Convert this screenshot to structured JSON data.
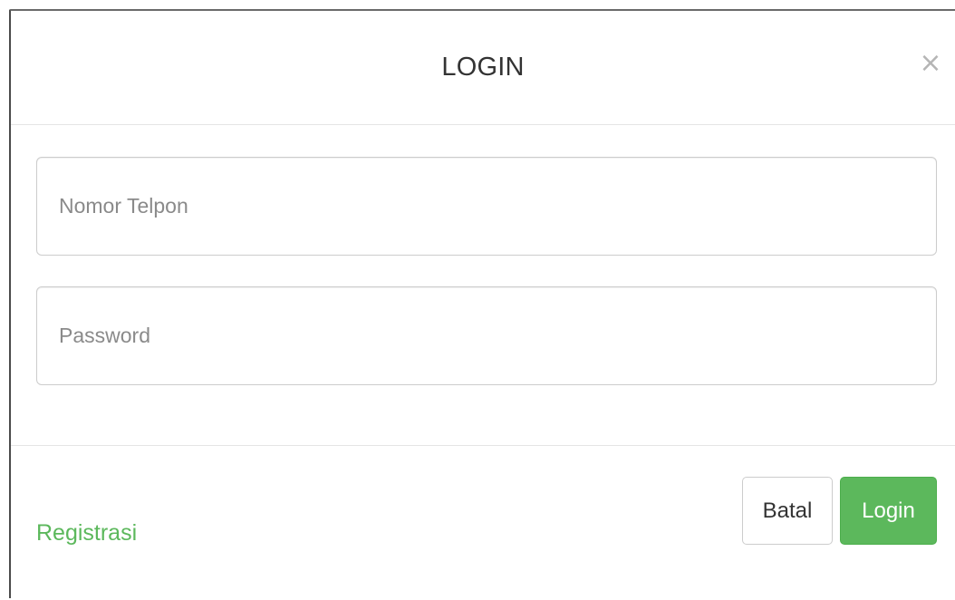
{
  "modal": {
    "title": "LOGIN",
    "close_symbol": "×"
  },
  "form": {
    "phone": {
      "placeholder": "Nomor Telpon",
      "value": ""
    },
    "password": {
      "placeholder": "Password",
      "value": ""
    }
  },
  "footer": {
    "register_label": "Registrasi",
    "cancel_label": "Batal",
    "login_label": "Login"
  },
  "colors": {
    "accent_green": "#5cb85c",
    "title_text": "#333333",
    "close_icon": "#b5b5b5",
    "border": "#cccccc"
  },
  "icons": {
    "close": "close-icon"
  }
}
